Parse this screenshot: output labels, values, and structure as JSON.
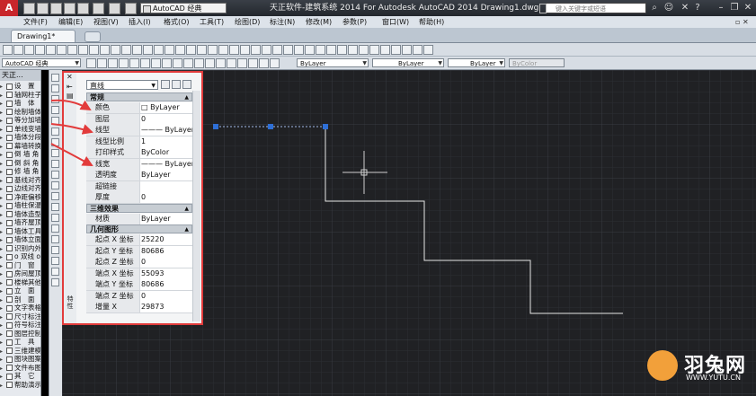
{
  "titlebar": {
    "workspace": "AutoCAD 经典",
    "title": "天正软件-建筑系统 2014  For Autodesk AutoCAD 2014   Drawing1.dwg",
    "search_placeholder": "键入关键字或短语"
  },
  "menu": [
    "文件(F)",
    "编辑(E)",
    "视图(V)",
    "插入(I)",
    "格式(O)",
    "工具(T)",
    "绘图(D)",
    "标注(N)",
    "修改(M)",
    "参数(P)",
    "窗口(W)",
    "帮助(H)"
  ],
  "tabs": [
    {
      "label": "Drawing1*"
    }
  ],
  "toolbar": {
    "workspace": "AutoCAD 经典",
    "layer_color": "ByLayer",
    "linetype": "ByLayer",
    "lineweight": "ByLayer",
    "plotstyle": "ByColor"
  },
  "tz_menu": {
    "header": "天正...",
    "items": [
      "设　置",
      "轴网柱子",
      "墙　体",
      "绘制墙体",
      "等分加墙",
      "单线变墙",
      "墙体分段",
      "幕墙转换",
      "倒 墙 角",
      "倒 斜 角",
      "修 墙 角",
      "基线对齐",
      "边线对齐",
      "净距偏移",
      "墙柱保温",
      "墙体造型",
      "墙齐屋顶",
      "墙体工具",
      "墙体立面",
      "识别内外",
      "o 双线 o",
      "门　窗",
      "房间屋顶",
      "楼梯其他",
      "立　面",
      "剖　面",
      "文字表格",
      "尺寸标注",
      "符号标注",
      "图层控制",
      "工　具",
      "三维建模",
      "图块图案",
      "文件布图",
      "其　它",
      "帮助演示"
    ]
  },
  "properties": {
    "object_type": "直线",
    "side_label": "特性",
    "sections": [
      {
        "title": "常规",
        "rows": [
          {
            "key": "颜色",
            "value": "□ ByLayer"
          },
          {
            "key": "图层",
            "value": "0"
          },
          {
            "key": "线型",
            "value": "——— ByLayer"
          },
          {
            "key": "线型比例",
            "value": "1"
          },
          {
            "key": "打印样式",
            "value": "ByColor"
          },
          {
            "key": "线宽",
            "value": "——— ByLayer"
          },
          {
            "key": "透明度",
            "value": "ByLayer"
          },
          {
            "key": "超链接",
            "value": ""
          },
          {
            "key": "厚度",
            "value": "0"
          }
        ]
      },
      {
        "title": "三维效果",
        "rows": [
          {
            "key": "材质",
            "value": "ByLayer"
          }
        ]
      },
      {
        "title": "几何图形",
        "rows": [
          {
            "key": "起点 X 坐标",
            "value": "25220"
          },
          {
            "key": "起点 Y 坐标",
            "value": "80686"
          },
          {
            "key": "起点 Z 坐标",
            "value": "0"
          },
          {
            "key": "端点 X 坐标",
            "value": "55093"
          },
          {
            "key": "端点 Y 坐标",
            "value": "80686"
          },
          {
            "key": "端点 Z 坐标",
            "value": "0"
          },
          {
            "key": "增量 X",
            "value": "29873"
          }
        ]
      }
    ]
  },
  "watermark": {
    "brand": "羽兔网",
    "url": "WWW.YUTU.CN"
  },
  "colors": {
    "annotation": "#e23b3b",
    "grip": "#2e6fd6",
    "canvas": "#202124",
    "line": "#e6e6e6"
  }
}
